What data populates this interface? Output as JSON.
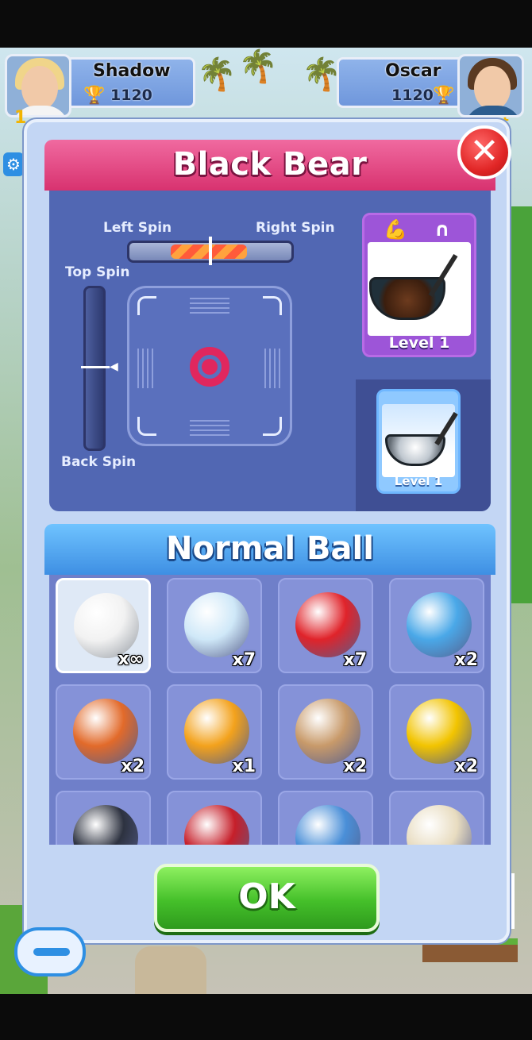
{
  "players": {
    "left": {
      "name": "Shadow",
      "trophies": "1120",
      "level_fragment": "1"
    },
    "right": {
      "name": "Oscar",
      "trophies": "1120",
      "fragment": "ot"
    }
  },
  "club": {
    "title": "Black Bear",
    "level_label": "Level 1",
    "alt_level_label": "Level 1",
    "stat_icons": [
      "power-icon",
      "accuracy-icon"
    ]
  },
  "spin": {
    "left_label": "Left Spin",
    "right_label": "Right Spin",
    "top_label": "Top Spin",
    "back_label": "Back Spin",
    "horizontal_fraction": 0.5,
    "vertical_fraction": 0.5
  },
  "balls": {
    "title": "Normal Ball",
    "items": [
      {
        "name": "white-golf-ball",
        "qty": "x∞",
        "color": "#f2f2f2",
        "selected": true
      },
      {
        "name": "snow-globe-ball",
        "qty": "x7",
        "color": "#cfe8f8"
      },
      {
        "name": "red-snowflake-ball",
        "qty": "x7",
        "color": "#e0232a"
      },
      {
        "name": "robot-ball",
        "qty": "x2",
        "color": "#4aa8e8"
      },
      {
        "name": "champion-ball",
        "qty": "x2",
        "color": "#e26a2a"
      },
      {
        "name": "pilgrim-turkey-ball",
        "qty": "x1",
        "color": "#f3a21c"
      },
      {
        "name": "eyeball-ball",
        "qty": "x2",
        "color": "#c89a6a"
      },
      {
        "name": "kangaroo-ball",
        "qty": "x2",
        "color": "#f2c400"
      },
      {
        "name": "dark-striped-ball",
        "qty": "",
        "color": "#2d3240"
      },
      {
        "name": "bat-ball",
        "qty": "",
        "color": "#c61f2a"
      },
      {
        "name": "earth-ball",
        "qty": "",
        "color": "#4a8fd8"
      },
      {
        "name": "mummy-ball",
        "qty": "",
        "color": "#e8dcc0"
      }
    ]
  },
  "buttons": {
    "ok": "OK",
    "close": "✕"
  }
}
